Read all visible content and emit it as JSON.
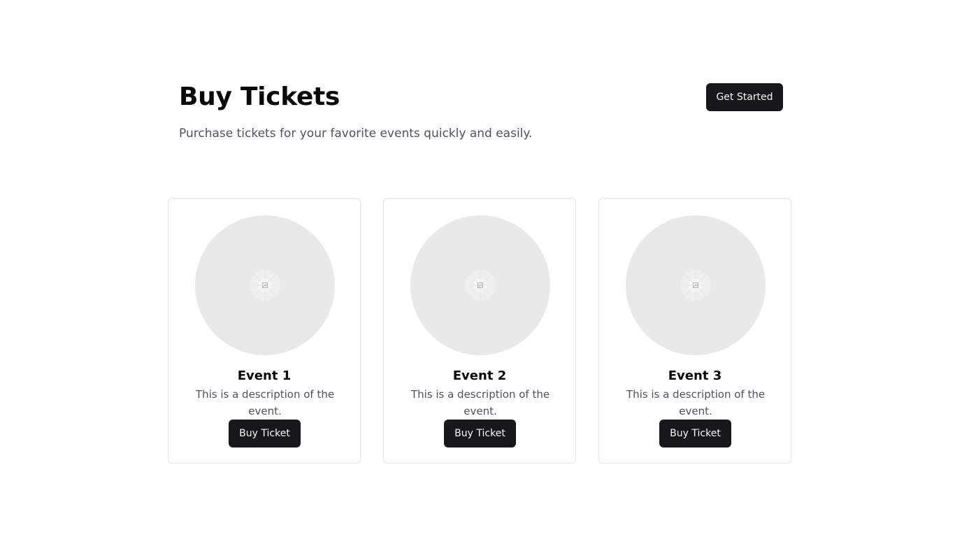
{
  "hero": {
    "title": "Buy Tickets",
    "subtitle": "Purchase tickets for your favorite events quickly and easily.",
    "cta_label": "Get Started"
  },
  "events": [
    {
      "title": "Event 1",
      "description": "This is a description of the event.",
      "button_label": "Buy Ticket",
      "image_icon": "image-placeholder-icon"
    },
    {
      "title": "Event 2",
      "description": "This is a description of the event.",
      "button_label": "Buy Ticket",
      "image_icon": "image-placeholder-icon"
    },
    {
      "title": "Event 3",
      "description": "This is a description of the event.",
      "button_label": "Buy Ticket",
      "image_icon": "image-placeholder-icon"
    }
  ],
  "colors": {
    "primary_button": "#18181b",
    "primary_button_text": "#fafafa",
    "muted_text": "#52525b",
    "card_border": "#e4e4e7",
    "placeholder_bg": "#e9e9e9"
  }
}
